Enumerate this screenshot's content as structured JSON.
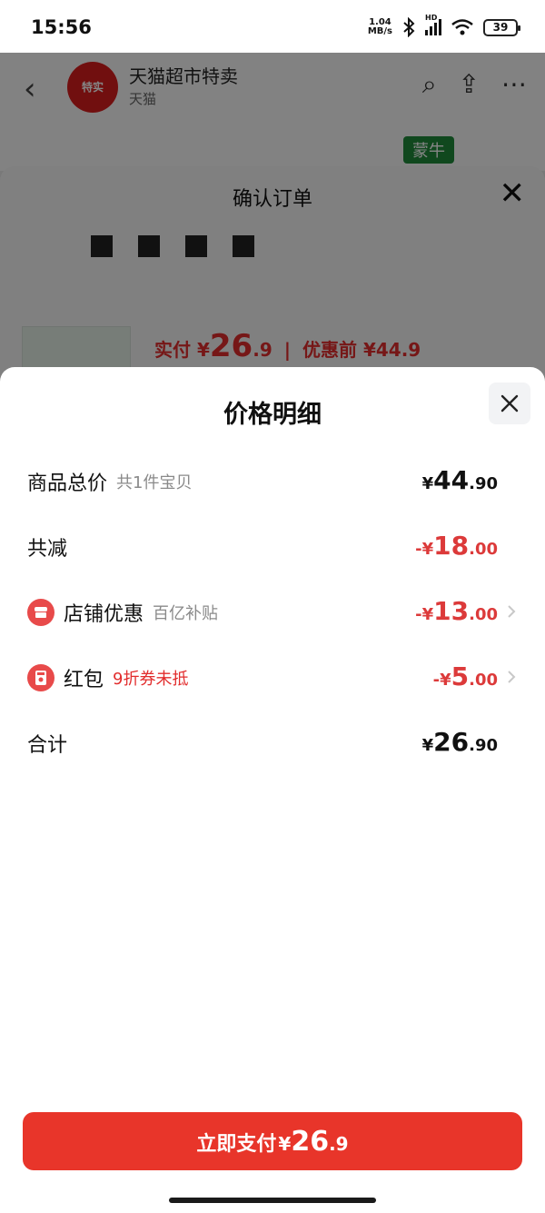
{
  "status_bar": {
    "time": "15:56",
    "net_speed_value": "1.04",
    "net_speed_unit": "MB/s",
    "hd_label": "HD",
    "battery": "39"
  },
  "background": {
    "store_logo_text": "特实",
    "store_name": "天猫超市特卖",
    "store_sub": "天猫",
    "brand_tag": "蒙牛",
    "sheet_title": "确认订单",
    "price_line": {
      "paid_label": "实付 ¥",
      "paid_int": "26",
      "paid_dec": ".9",
      "separator": "|",
      "original_label": "优惠前 ¥44.9"
    }
  },
  "price_detail": {
    "title": "价格明细",
    "rows": [
      {
        "label": "商品总价",
        "sub": "共1件宝贝",
        "sign": "",
        "symbol": "¥",
        "int": "44",
        "dec": ".90"
      },
      {
        "label": "共减",
        "sub": "",
        "sign": "-",
        "symbol": "¥",
        "int": "18",
        "dec": ".00"
      },
      {
        "label": "店铺优惠",
        "sub": "百亿补贴",
        "sign": "-",
        "symbol": "¥",
        "int": "13",
        "dec": ".00",
        "icon": "store-icon"
      },
      {
        "label": "红包",
        "sub": "9折券未抵",
        "sign": "-",
        "symbol": "¥",
        "int": "5",
        "dec": ".00",
        "icon": "red-packet-icon"
      },
      {
        "label": "合计",
        "sub": "",
        "sign": "",
        "symbol": "¥",
        "int": "26",
        "dec": ".90"
      }
    ]
  },
  "pay_button": {
    "label": "立即支付",
    "symbol": "¥",
    "int": "26",
    "dec": ".9"
  },
  "colors": {
    "accent_red": "#e8352a",
    "discount_red": "#dc3a3a",
    "coupon_red": "#e22d2d"
  }
}
